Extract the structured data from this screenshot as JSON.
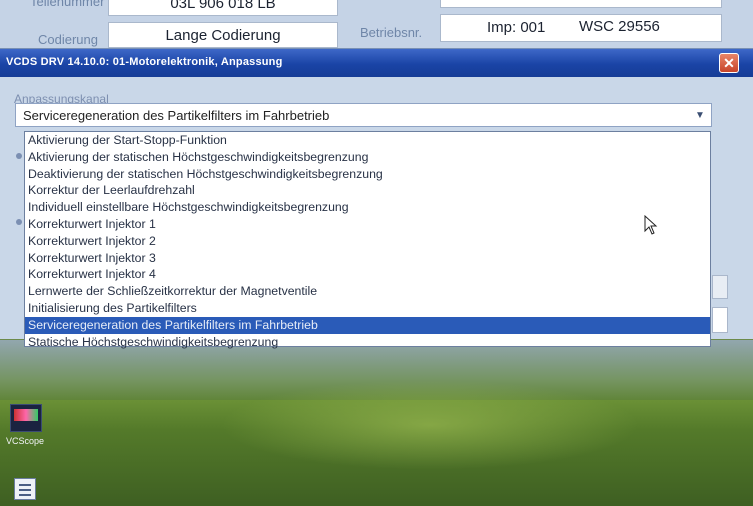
{
  "parent_window": {
    "teilenummer_label": "Teilenummer",
    "teilenummer_value": "03L 906 018 LB",
    "codierung_label": "Codierung",
    "codierung_value": "Lange Codierung",
    "betriebsnr_label": "Betriebsnr.",
    "imp_value": "Imp: 001",
    "wsc_value": "WSC 29556"
  },
  "dialog": {
    "title": "VCDS DRV 14.10.0: 01-Motorelektronik,  Anpassung",
    "close_glyph": "✕",
    "group_label": "Anpassungskanal",
    "selected_channel": "Serviceregeneration des Partikelfilters im Fahrbetrieb",
    "dropdown_arrow_icon": "chevron-down-icon",
    "options": [
      "Aktivierung der Start-Stopp-Funktion",
      "Aktivierung der statischen Höchstgeschwindigkeitsbegrenzung",
      "Deaktivierung der statischen Höchstgeschwindigkeitsbegrenzung",
      "Korrektur der Leerlaufdrehzahl",
      "Individuell einstellbare Höchstgeschwindigkeitsbegrenzung",
      "Korrekturwert Injektor 1",
      "Korrekturwert Injektor 2",
      "Korrekturwert Injektor 3",
      "Korrekturwert Injektor 4",
      "Lernwerte der Schließzeitkorrektur der Magnetventile",
      "Initialisierung des Partikelfilters",
      "Serviceregeneration des Partikelfilters im Fahrbetrieb",
      "Statische Höchstgeschwindigkeitsbegrenzung"
    ],
    "selected_index": 11
  },
  "desktop": {
    "icons": [
      {
        "label": "VCScope",
        "icon": "vcscope-icon"
      },
      {
        "label": "",
        "icon": "document-icon"
      }
    ]
  },
  "colors": {
    "titlebar": "#1a44a6",
    "selection": "#2a5bb8",
    "dialog_bg": "#c9d7e8"
  }
}
